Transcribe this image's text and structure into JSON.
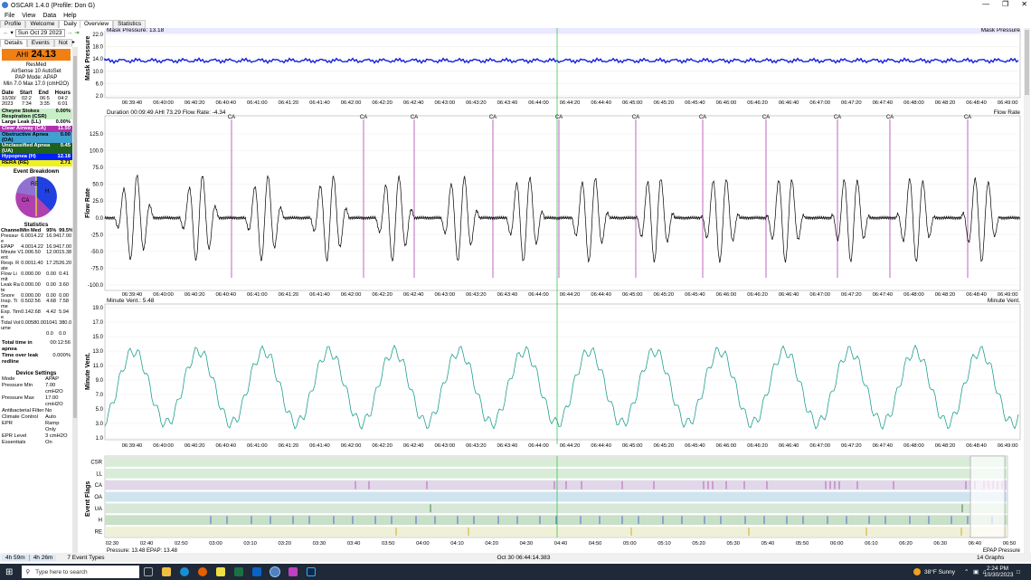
{
  "window": {
    "title": "OSCAR 1.4.0 (Profile: Don G)"
  },
  "menu": [
    "File",
    "View",
    "Data",
    "Help"
  ],
  "left_tabs": [
    "Profile",
    "Welcome",
    "Daily"
  ],
  "date": {
    "label": "Sun Oct 29 2023"
  },
  "sub_tabs": [
    "Details",
    "Events",
    "Not"
  ],
  "ahi": {
    "label": "AHI",
    "value": "24.13"
  },
  "device": {
    "brand": "ResMed",
    "model": "AirSense 10 AutoSet",
    "mode": "PAP Mode: APAP",
    "range": "Min 7.0 Max 17.0 (cmH2O)"
  },
  "session": {
    "headers": [
      "Date",
      "Start",
      "End",
      "Hours"
    ],
    "values": [
      "10/30/2023",
      "02:27:34",
      "06:53:35",
      "04:26:01"
    ]
  },
  "events": [
    {
      "label": "Cheyne Stokes Respiration (CSR)",
      "value": "0.00%",
      "color": "#c8f0c8"
    },
    {
      "label": "Large Leak (LL)",
      "value": "0.00%",
      "color": "#ffffff"
    },
    {
      "label": "Clear Airway (CA)",
      "value": "11.50",
      "color": "#b030b0",
      "fg": "#fff"
    },
    {
      "label": "Obstructive Apnea (OA)",
      "value": "0.00",
      "color": "#40a0d0"
    },
    {
      "label": "Unclassified Apnea (UA)",
      "value": "0.45",
      "color": "#206020",
      "fg": "#fff"
    },
    {
      "label": "Hypopnea (H)",
      "value": "12.18",
      "color": "#0020ff",
      "fg": "#fff"
    },
    {
      "label": "RERA (RE)",
      "value": "2.71",
      "color": "#f0f020"
    }
  ],
  "breakdown": {
    "title": "Event Breakdown",
    "labels": [
      "RE",
      "CA",
      "H"
    ]
  },
  "statistics": {
    "title": "Statistics",
    "headers": [
      "Channel",
      "Min",
      "Med",
      "95%",
      "99.5%"
    ],
    "rows": [
      [
        "Pressure",
        "6.00",
        "14.22",
        "16.94",
        "17.00"
      ],
      [
        "EPAP",
        "4.00",
        "14.22",
        "16.94",
        "17.00"
      ],
      [
        "Minute Vent",
        "1.00",
        "6.50",
        "12.00",
        "15.38"
      ],
      [
        "Resp. Rate",
        "0.00",
        "11.40",
        "17.25",
        "26.20"
      ],
      [
        "Flow Limit",
        "0.00",
        "0.00",
        "0.00",
        "0.41"
      ],
      [
        "Leak Rate",
        "0.00",
        "0.00",
        "0.00",
        "3.60"
      ],
      [
        "Snore",
        "0.00",
        "0.00",
        "0.00",
        "0.00"
      ],
      [
        "Insp. Time",
        "0.50",
        "2.56",
        "4.68",
        "7.58"
      ],
      [
        "Exp. Time",
        "0.14",
        "2.68",
        "4.42",
        "5.94"
      ],
      [
        "Tidal Volume",
        "0.00",
        "580.00",
        "1041",
        "380.0"
      ],
      [
        "",
        "",
        "",
        "0.0",
        "0.0"
      ]
    ],
    "apnea_time_label": "Total time in apnea",
    "apnea_time": "00:12:56",
    "redline_label": "Time over leak redline",
    "redline": "0.000%"
  },
  "device_settings": {
    "title": "Device Settings",
    "rows": [
      [
        "Mode",
        "APAP"
      ],
      [
        "Pressure Min",
        "7.00 cmH2O"
      ],
      [
        "Pressure Max",
        "17.00 cmH2O"
      ],
      [
        "Antibacterial Filter",
        "No"
      ],
      [
        "Climate Control",
        "Auto"
      ],
      [
        "EPR",
        "Ramp Only"
      ],
      [
        "EPR Level",
        "3 cmH2O"
      ],
      [
        "Essentials",
        "On"
      ]
    ]
  },
  "main_tabs": [
    "Overview",
    "Statistics"
  ],
  "graphs": {
    "mask_pressure": {
      "title": "Mask Pressure",
      "readout": "Mask Pressure: 13.18",
      "yticks": [
        "22.0",
        "18.0",
        "14.0",
        "10.0",
        "6.0",
        "2.0"
      ]
    },
    "flow_rate": {
      "title": "Flow Rate",
      "readout": "Duration 00:09:49 AHI 73.29 Flow Rate: -4.34",
      "yticks": [
        "125.0",
        "100.0",
        "75.0",
        "50.0",
        "25.0",
        "0.0",
        "-25.0",
        "-50.0",
        "-75.0",
        "-100.0"
      ]
    },
    "minute_vent": {
      "title": "Minute Vent.",
      "readout": "Minute Vent.: 5.48",
      "yticks": [
        "19.0",
        "17.0",
        "15.0",
        "13.0",
        "11.0",
        "9.0",
        "7.0",
        "5.0",
        "3.0",
        "1.0"
      ]
    },
    "event_flags": {
      "title": "Event Flags",
      "rows": [
        "CSR",
        "LL",
        "CA",
        "OA",
        "UA",
        "H",
        "RE"
      ]
    },
    "pressure_bottom": {
      "title": "EPAP Pressure",
      "readout": "Pressure: 13.48 EPAP: 13.48"
    }
  },
  "time_ticks": [
    "06:39:40",
    "06:40:00",
    "06:40:20",
    "06:40:40",
    "06:41:00",
    "06:41:20",
    "06:41:40",
    "06:42:00",
    "06:42:20",
    "06:42:40",
    "06:43:00",
    "06:43:20",
    "06:43:40",
    "06:44:00",
    "06:44:20",
    "06:44:40",
    "06:45:00",
    "06:45:20",
    "06:45:40",
    "06:46:00",
    "06:46:20",
    "06:46:40",
    "06:47:00",
    "06:47:20",
    "06:47:40",
    "06:48:00",
    "06:48:20",
    "06:48:40",
    "06:49:00"
  ],
  "overview_ticks": [
    "02:30",
    "02:40",
    "02:50",
    "03:00",
    "03:10",
    "03:20",
    "03:30",
    "03:40",
    "03:50",
    "04:00",
    "04:10",
    "04:20",
    "04:30",
    "04:40",
    "04:50",
    "05:00",
    "05:10",
    "05:20",
    "05:30",
    "05:40",
    "05:50",
    "06:00",
    "06:10",
    "06:20",
    "06:30",
    "06:40",
    "06:50"
  ],
  "ca_marker": "CA",
  "statusbar": {
    "left1": "4h 59m",
    "left2": "4h 26m",
    "events": "7 Event Types",
    "cursor": "Oct 30 06:44:14.383",
    "graphs": "14 Graphs"
  },
  "taskbar": {
    "search": "Type here to search",
    "weather": "38°F Sunny",
    "time": "2:24 PM",
    "date": "10/30/2023"
  }
}
